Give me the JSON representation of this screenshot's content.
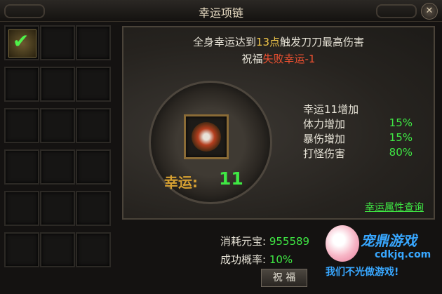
{
  "window": {
    "title": "幸运项链",
    "close_icon": "close-icon"
  },
  "bag": {
    "rows": 6,
    "cols": 3,
    "items": [
      {
        "slot": 0,
        "icon": "necklace-icon",
        "selected": true,
        "check_icon": "checkmark-icon"
      }
    ]
  },
  "panel": {
    "bonus_prefix": "全身幸运达到",
    "bonus_level": "13点",
    "bonus_mid": "触发刀刀最高伤害",
    "bless_prefix": "祝福",
    "bless_penalty": "失败幸运-1",
    "luck_label": "幸运:",
    "luck_value": "11",
    "stats": [
      {
        "label": "幸运11增加",
        "value": ""
      },
      {
        "label": "体力增加",
        "value": "15%"
      },
      {
        "label": "暴伤增加",
        "value": "15%"
      },
      {
        "label": "打怪伤害",
        "value": "80%"
      }
    ],
    "link": "幸运属性查询"
  },
  "cost": {
    "label": "消耗元宝:",
    "value": "955589"
  },
  "rate": {
    "label": "成功概率:",
    "value": "10%"
  },
  "bless_button": "祝 福",
  "watermark": {
    "name": "宠鼎游戏",
    "url": "cdkjq.com",
    "slogan": "我们不光做游戏!"
  },
  "colors": {
    "highlight_green": "#3fe844",
    "highlight_red": "#f05131",
    "highlight_yellow": "#f2c84a"
  }
}
